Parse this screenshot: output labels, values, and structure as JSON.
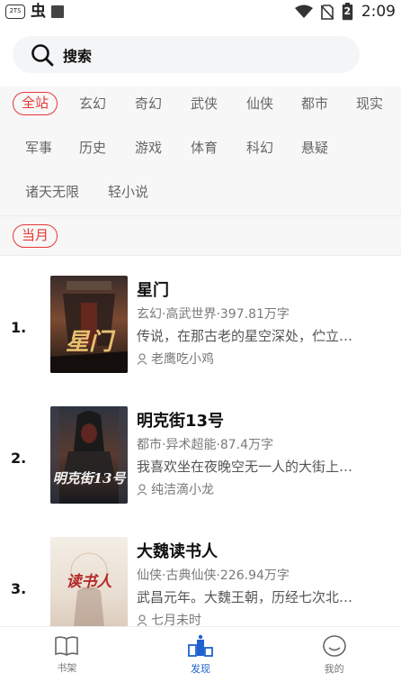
{
  "status_bar": {
    "badge": "2TS",
    "bug_icon": "虫",
    "battery_level": "2",
    "time": "2:09"
  },
  "search": {
    "label": "搜索"
  },
  "filters": {
    "categories": [
      {
        "label": "全站",
        "selected": true
      },
      {
        "label": "玄幻",
        "selected": false
      },
      {
        "label": "奇幻",
        "selected": false
      },
      {
        "label": "武侠",
        "selected": false
      },
      {
        "label": "仙侠",
        "selected": false
      },
      {
        "label": "都市",
        "selected": false
      },
      {
        "label": "现实",
        "selected": false
      },
      {
        "label": "军事",
        "selected": false
      },
      {
        "label": "历史",
        "selected": false
      },
      {
        "label": "游戏",
        "selected": false
      },
      {
        "label": "体育",
        "selected": false
      },
      {
        "label": "科幻",
        "selected": false
      },
      {
        "label": "悬疑",
        "selected": false
      },
      {
        "label": "诸天无限",
        "selected": false
      },
      {
        "label": "轻小说",
        "selected": false
      }
    ],
    "period": {
      "label": "当月",
      "selected": true
    }
  },
  "books": [
    {
      "rank": "1.",
      "title": "星门",
      "meta": "玄幻·高武世界·397.81万字",
      "desc": "传说，在那古老的星空深处，伫立…",
      "author": "老鹰吃小鸡",
      "cover_text": "星门",
      "cover_colors": [
        "#3a2c2a",
        "#7a4a32",
        "#1c1412"
      ],
      "cover_accent": "#e8c070"
    },
    {
      "rank": "2.",
      "title": "明克街13号",
      "meta": "都市·异术超能·87.4万字",
      "desc": "我喜欢坐在夜晚空无一人的大街上…",
      "author": "纯洁滴小龙",
      "cover_text": "明克街13号",
      "cover_colors": [
        "#2e3440",
        "#5a3a2e",
        "#16181d"
      ],
      "cover_accent": "#f2f2f2"
    },
    {
      "rank": "3.",
      "title": "大魏读书人",
      "meta": "仙侠·古典仙侠·226.94万字",
      "desc": "武昌元年。大魏王朝，历经七次北…",
      "author": "七月未时",
      "cover_text": "读书人",
      "cover_colors": [
        "#f4eee6",
        "#e8ddd0",
        "#d9c8b8"
      ],
      "cover_accent": "#b32a2a"
    }
  ],
  "bottom_nav": [
    {
      "label": "书架",
      "icon": "book-icon",
      "active": false
    },
    {
      "label": "发现",
      "icon": "discover-icon",
      "active": true
    },
    {
      "label": "我的",
      "icon": "profile-icon",
      "active": false
    }
  ],
  "colors": {
    "accent_red": "#e53935",
    "active_blue": "#1e62d0"
  }
}
